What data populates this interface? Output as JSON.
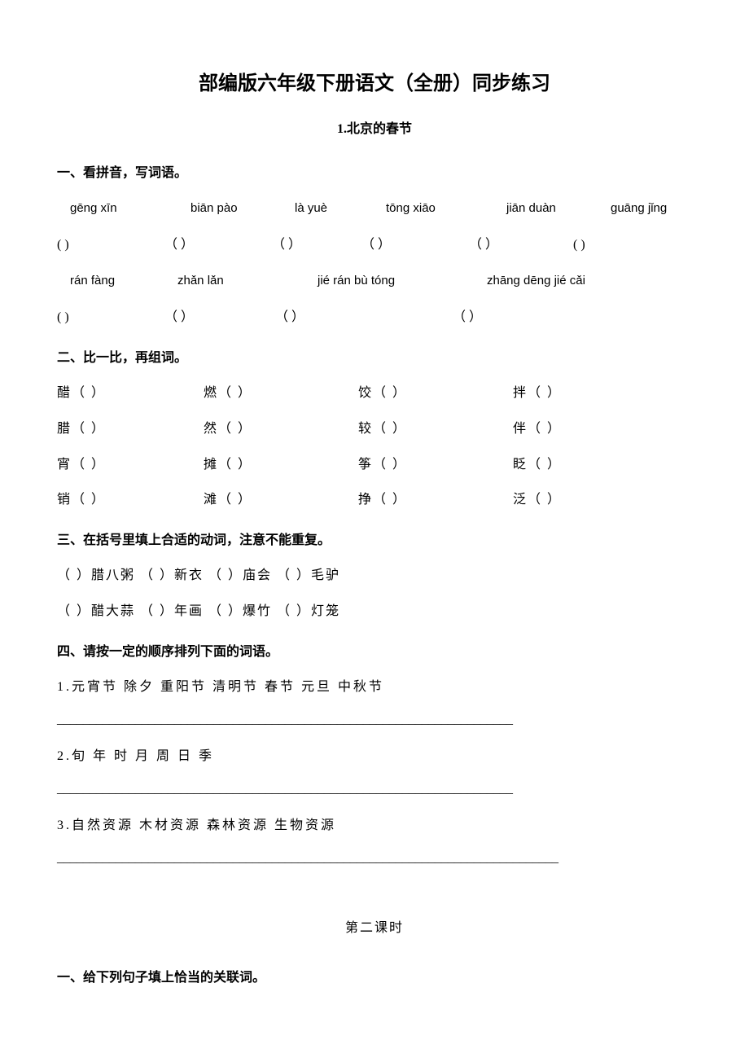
{
  "title": "部编版六年级下册语文（全册）同步练习",
  "subtitle": "1.北京的春节",
  "section1": {
    "heading": "一、看拼音，写词语。",
    "pinyinRow1": {
      "p1": "gēng xīn",
      "p2": "biān pào",
      "p3": "là yuè",
      "p4": "tōng xiāo",
      "p5": "jiān duàn",
      "p6": "guāng jǐng"
    },
    "parenRow1": {
      "b1": "(            )",
      "b2": "（            ）",
      "b3": "（         ）",
      "b4": "（            ）",
      "b5": "（            ）",
      "b6": "(                )"
    },
    "pinyinRow2": {
      "p1": "rán fàng",
      "p2": "zhǎn lǎn",
      "p3": "jié rán bù tóng",
      "p4": "zhāng dēng jié cǎi"
    },
    "parenRow2": {
      "b1": "(            )",
      "b2": "（            ）",
      "b3": "（                        ）",
      "b4": "（                            ）"
    }
  },
  "section2": {
    "heading": "二、比一比，再组词。",
    "rows": [
      {
        "c1": "醋（      ）",
        "c2": "燃（        ）",
        "c3": "饺（        ）",
        "c4": "拌（        ）"
      },
      {
        "c1": "腊（     ）",
        "c2": "然（        ）",
        "c3": "较（        ）",
        "c4": "伴（        ）"
      },
      {
        "c1": "宵（      ）",
        "c2": "摊（        ）",
        "c3": "筝（        ）",
        "c4": "眨（        ）"
      },
      {
        "c1": "销（     ）",
        "c2": "滩（        ）",
        "c3": "挣（        ）",
        "c4": "泛（        ）"
      }
    ]
  },
  "section3": {
    "heading": "三、在括号里填上合适的动词，注意不能重复。",
    "row1": "（    ）腊八粥      （    ）新衣      （      ）庙会    （    ）毛驴",
    "row2": "（    ）醋大蒜      （    ）年画      （      ）爆竹    （    ）灯笼"
  },
  "section4": {
    "heading": "四、请按一定的顺序排列下面的词语。",
    "item1": "1.元宵节    除夕    重阳节    清明节    春节    元旦    中秋节",
    "line1": "______________________________________________________________________",
    "item2": "2.旬    年    时    月    周    日    季",
    "line2": "______________________________________________________________________",
    "item3": "3.自然资源    木材资源    森林资源    生物资源",
    "line3": "_____________________________________________________________________________"
  },
  "lesson2": {
    "title": "第二课时",
    "section1Heading": "一、给下列句子填上恰当的关联词。"
  }
}
